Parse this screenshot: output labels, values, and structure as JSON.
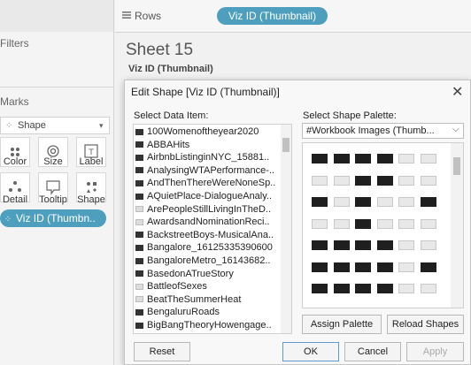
{
  "shelves": {
    "rows_label": "Rows",
    "rows_pill": "Viz ID (Thumbnail)"
  },
  "left_pane": {
    "filters_title": "Filters",
    "marks_title": "Marks",
    "mark_type": "Shape",
    "mark_buttons": [
      "Color",
      "Size",
      "Label",
      "Detail",
      "Tooltip",
      "Shape"
    ],
    "viz_pill": "Viz ID (Thumbn.."
  },
  "sheet": {
    "title": "Sheet 15",
    "subtitle": "Viz ID (Thumbnail)"
  },
  "dialog": {
    "title": "Edit Shape [Viz ID (Thumbnail)]",
    "select_data_item_label": "Select Data Item:",
    "select_palette_label": "Select Shape Palette:",
    "palette_value": "#Workbook Images (Thumb...",
    "data_items": [
      "100Womenoftheyear2020",
      "ABBAHits",
      "AirbnbListinginNYC_15881..",
      "AnalysingWTAPerformance-..",
      "AndThenThereWereNoneSp..",
      "AQuietPlace-DialogueAnaly..",
      "ArePeopleStillLivingInTheD..",
      "AwardsandNominationReci..",
      "BackstreetBoys-MusicalAna..",
      "Bangalore_16125335390600",
      "BangaloreMetro_16143682..",
      "BasedonATrueStory",
      "BattleofSexes",
      "BeatTheSummerHeat",
      "BengaluruRoads",
      "BigBangTheoryHowengage.."
    ],
    "light_items": [
      6,
      7,
      12,
      13
    ],
    "buttons": {
      "assign_palette": "Assign Palette",
      "reload_shapes": "Reload Shapes",
      "reset": "Reset",
      "ok": "OK",
      "cancel": "Cancel",
      "apply": "Apply"
    },
    "close_glyph": "✕"
  }
}
